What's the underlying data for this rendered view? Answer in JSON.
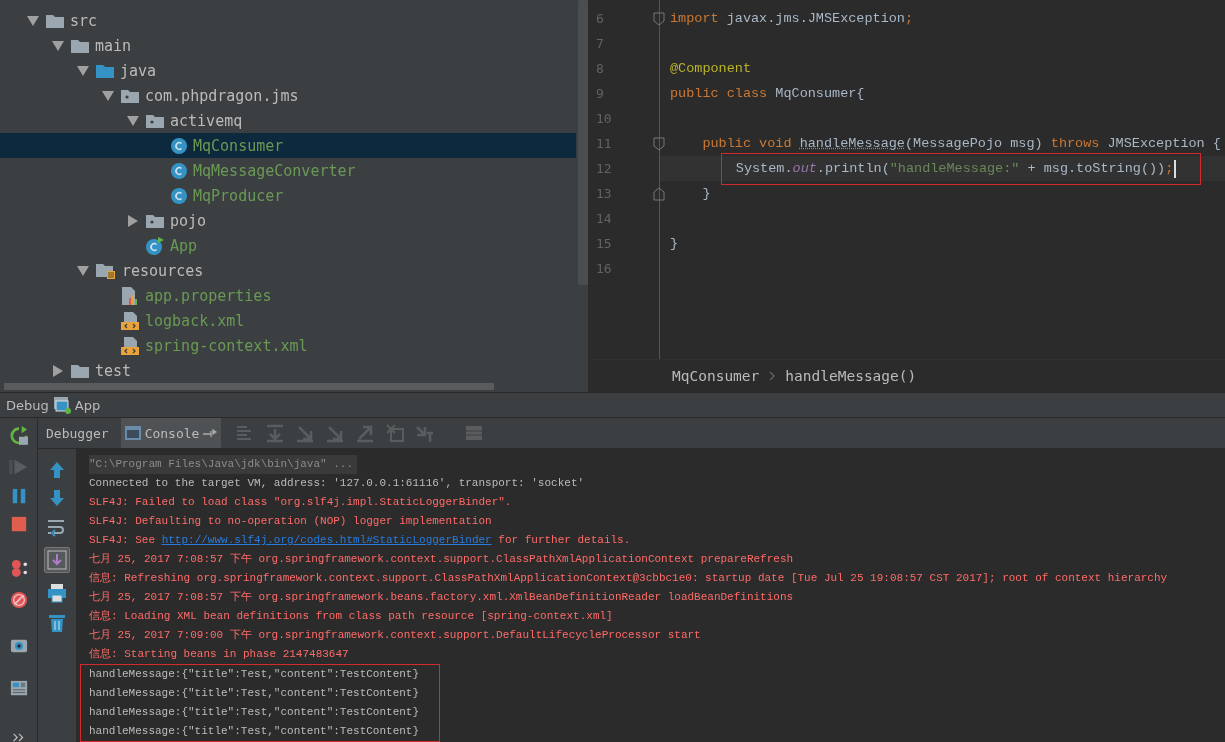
{
  "project_tree": {
    "items": [
      {
        "label": "src",
        "kind": "folder",
        "expanded": true,
        "selected": false,
        "children": [
          {
            "label": "main",
            "kind": "folder",
            "expanded": true,
            "selected": false,
            "children": [
              {
                "label": "java",
                "kind": "source-folder",
                "expanded": true,
                "selected": false,
                "children": [
                  {
                    "label": "com.phpdragon.jms",
                    "kind": "package",
                    "expanded": true,
                    "selected": false,
                    "children": [
                      {
                        "label": "activemq",
                        "kind": "package",
                        "expanded": true,
                        "selected": false,
                        "children": [
                          {
                            "label": "MqConsumer",
                            "kind": "class",
                            "selected": true
                          },
                          {
                            "label": "MqMessageConverter",
                            "kind": "class",
                            "selected": false
                          },
                          {
                            "label": "MqProducer",
                            "kind": "class",
                            "selected": false
                          }
                        ]
                      },
                      {
                        "label": "pojo",
                        "kind": "package",
                        "expanded": false,
                        "selected": false
                      },
                      {
                        "label": "App",
                        "kind": "main-class",
                        "selected": false
                      }
                    ]
                  }
                ]
              },
              {
                "label": "resources",
                "kind": "resource-folder",
                "expanded": true,
                "selected": false,
                "children": [
                  {
                    "label": "app.properties",
                    "kind": "properties",
                    "selected": false
                  },
                  {
                    "label": "logback.xml",
                    "kind": "xml",
                    "selected": false
                  },
                  {
                    "label": "spring-context.xml",
                    "kind": "xml",
                    "selected": false
                  }
                ]
              }
            ]
          },
          {
            "label": "test",
            "kind": "folder",
            "expanded": false,
            "selected": false
          }
        ]
      }
    ]
  },
  "editor": {
    "lines": [
      {
        "number": "6",
        "fold_start": true,
        "tokens": [
          {
            "text": "import ",
            "kind": "keyword"
          },
          {
            "text": "javax.jms.JMSException",
            "kind": "plain"
          },
          {
            "text": ";",
            "kind": "keyword"
          }
        ]
      },
      {
        "number": "7"
      },
      {
        "number": "8",
        "tokens": [
          {
            "text": "@Component",
            "kind": "annotation"
          }
        ]
      },
      {
        "number": "9",
        "tokens": [
          {
            "text": "public class ",
            "kind": "keyword"
          },
          {
            "text": "MqConsumer{",
            "kind": "plain"
          }
        ]
      },
      {
        "number": "10"
      },
      {
        "number": "11",
        "fold_start": true,
        "tokens": [
          {
            "text": "    public void ",
            "kind": "keyword"
          },
          {
            "text": "handleMessage",
            "kind": "unused"
          },
          {
            "text": "(MessagePojo msg) ",
            "kind": "plain"
          },
          {
            "text": "throws ",
            "kind": "keyword"
          },
          {
            "text": "JMSException {",
            "kind": "plain"
          }
        ]
      },
      {
        "number": "12",
        "current": true,
        "boxed": true,
        "tokens": [
          {
            "text": "        System.",
            "kind": "plain"
          },
          {
            "text": "out",
            "kind": "field"
          },
          {
            "text": ".println(",
            "kind": "plain"
          },
          {
            "text": "\"handleMessage:\"",
            "kind": "string"
          },
          {
            "text": " + msg.toString())",
            "kind": "plain"
          },
          {
            "text": ";",
            "kind": "keyword"
          }
        ]
      },
      {
        "number": "13",
        "fold_end": true,
        "tokens": [
          {
            "text": "    }",
            "kind": "plain"
          }
        ]
      },
      {
        "number": "14"
      },
      {
        "number": "15",
        "tokens": [
          {
            "text": "}",
            "kind": "plain"
          }
        ]
      },
      {
        "number": "16"
      }
    ],
    "breadcrumbs": [
      "MqConsumer",
      "handleMessage()"
    ]
  },
  "debug": {
    "title": "Debug",
    "config": "App",
    "tabs": [
      {
        "label": "Debugger",
        "selected": false
      },
      {
        "label": "Console",
        "selected": true
      }
    ],
    "console": {
      "lines": [
        {
          "kind": "command",
          "segments": [
            {
              "text": "\"C:\\Program Files\\Java\\jdk\\bin\\java\" ..."
            }
          ]
        },
        {
          "kind": "normal",
          "segments": [
            {
              "text": "Connected to the target VM, address: '127.0.0.1:61116', transport: 'socket'"
            }
          ]
        },
        {
          "kind": "error",
          "segments": [
            {
              "text": "SLF4J: Failed to load class \"org.slf4j.impl.StaticLoggerBinder\"."
            }
          ]
        },
        {
          "kind": "error",
          "segments": [
            {
              "text": "SLF4J: Defaulting to no-operation (NOP) logger implementation"
            }
          ]
        },
        {
          "kind": "error",
          "segments": [
            {
              "text": "SLF4J: See "
            },
            {
              "text": "http://www.slf4j.org/codes.html#StaticLoggerBinder",
              "link": true
            },
            {
              "text": " for further details."
            }
          ]
        },
        {
          "kind": "error",
          "segments": [
            {
              "text": "七月 25, 2017 7:08:57 下午 org.springframework.context.support.ClassPathXmlApplicationContext prepareRefresh"
            }
          ]
        },
        {
          "kind": "error",
          "segments": [
            {
              "text": "信息: Refreshing org.springframework.context.support.ClassPathXmlApplicationContext@3cbbc1e0: startup date [Tue Jul 25 19:08:57 CST 2017]; root of context hierarchy"
            }
          ]
        },
        {
          "kind": "error",
          "segments": [
            {
              "text": "七月 25, 2017 7:08:57 下午 org.springframework.beans.factory.xml.XmlBeanDefinitionReader loadBeanDefinitions"
            }
          ]
        },
        {
          "kind": "error",
          "segments": [
            {
              "text": "信息: Loading XML bean definitions from class path resource [spring-context.xml]"
            }
          ]
        },
        {
          "kind": "error",
          "segments": [
            {
              "text": "七月 25, 2017 7:09:00 下午 org.springframework.context.support.DefaultLifecycleProcessor start"
            }
          ]
        },
        {
          "kind": "error",
          "segments": [
            {
              "text": "信息: Starting beans in phase 2147483647"
            }
          ]
        }
      ],
      "boxed_lines": [
        "handleMessage:{\"title\":Test,\"content\":TestContent}",
        "handleMessage:{\"title\":Test,\"content\":TestContent}",
        "handleMessage:{\"title\":Test,\"content\":TestContent}",
        "handleMessage:{\"title\":Test,\"content\":TestContent}"
      ]
    }
  }
}
